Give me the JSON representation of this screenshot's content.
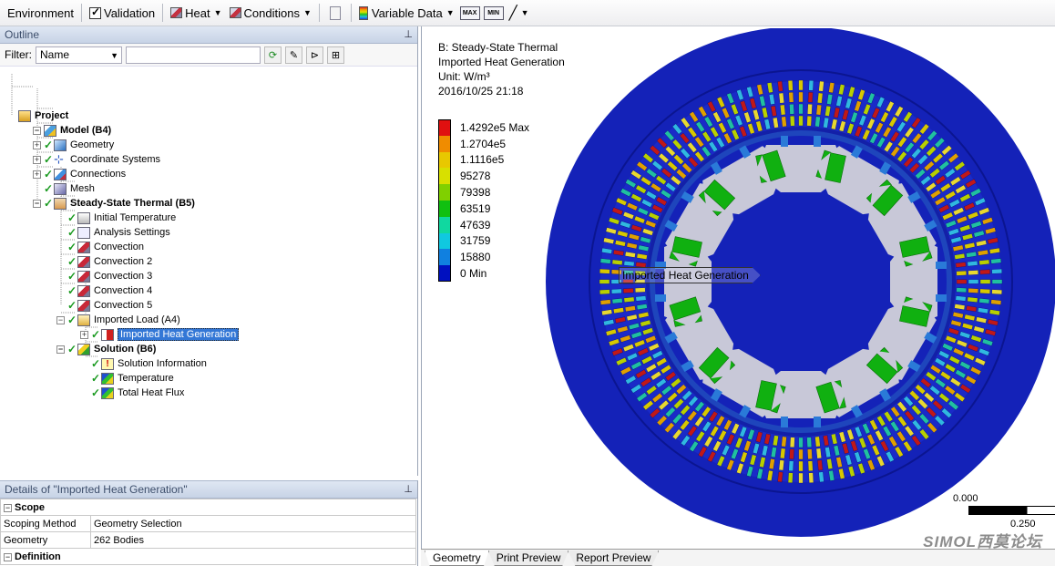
{
  "toolbar": {
    "environment": "Environment",
    "validation": "Validation",
    "heat": "Heat",
    "conditions": "Conditions",
    "variable_data": "Variable Data",
    "max_icon": "MAX",
    "min_icon": "MIN"
  },
  "outline": {
    "title": "Outline",
    "filter_label": "Filter:",
    "filter_value": "Name",
    "tree": [
      {
        "label": "Project",
        "level": 0,
        "bold": true,
        "icon": "project-icon",
        "tick": false,
        "expander": ""
      },
      {
        "label": "Model (B4)",
        "level": 1,
        "bold": true,
        "icon": "model-icon",
        "tick": false,
        "expander": "−"
      },
      {
        "label": "Geometry",
        "level": 2,
        "bold": false,
        "icon": "geometry-icon",
        "tick": true,
        "expander": "+"
      },
      {
        "label": "Coordinate Systems",
        "level": 2,
        "bold": false,
        "icon": "coordinate-icon",
        "tick": true,
        "expander": "+"
      },
      {
        "label": "Connections",
        "level": 2,
        "bold": false,
        "icon": "connections-icon",
        "tick": true,
        "expander": "+"
      },
      {
        "label": "Mesh",
        "level": 2,
        "bold": false,
        "icon": "mesh-icon",
        "tick": true,
        "expander": ""
      },
      {
        "label": "Steady-State Thermal (B5)",
        "level": 2,
        "bold": true,
        "icon": "thermal-icon",
        "tick": true,
        "expander": "−"
      },
      {
        "label": "Initial Temperature",
        "level": 3,
        "bold": false,
        "icon": "initial-temperature-icon",
        "tick": true,
        "expander": ""
      },
      {
        "label": "Analysis Settings",
        "level": 3,
        "bold": false,
        "icon": "settings-icon",
        "tick": true,
        "expander": ""
      },
      {
        "label": "Convection",
        "level": 3,
        "bold": false,
        "icon": "convection-icon",
        "tick": true,
        "expander": ""
      },
      {
        "label": "Convection 2",
        "level": 3,
        "bold": false,
        "icon": "convection-icon",
        "tick": true,
        "expander": ""
      },
      {
        "label": "Convection 3",
        "level": 3,
        "bold": false,
        "icon": "convection-icon",
        "tick": true,
        "expander": ""
      },
      {
        "label": "Convection 4",
        "level": 3,
        "bold": false,
        "icon": "convection-icon",
        "tick": true,
        "expander": ""
      },
      {
        "label": "Convection 5",
        "level": 3,
        "bold": false,
        "icon": "convection-icon",
        "tick": true,
        "expander": ""
      },
      {
        "label": "Imported Load (A4)",
        "level": 3,
        "bold": false,
        "icon": "imported-load-icon",
        "tick": true,
        "expander": "−"
      },
      {
        "label": "Imported Heat Generation",
        "level": 4,
        "bold": false,
        "icon": "heat-generation-icon",
        "tick": true,
        "expander": "+",
        "selected": true
      },
      {
        "label": "Solution (B6)",
        "level": 3,
        "bold": true,
        "icon": "solution-icon",
        "tick": true,
        "expander": "−"
      },
      {
        "label": "Solution Information",
        "level": 4,
        "bold": false,
        "icon": "solution-info-icon",
        "tick": true,
        "expander": ""
      },
      {
        "label": "Temperature",
        "level": 4,
        "bold": false,
        "icon": "result-icon",
        "tick": true,
        "expander": ""
      },
      {
        "label": "Total Heat Flux",
        "level": 4,
        "bold": false,
        "icon": "result-icon",
        "tick": true,
        "expander": ""
      }
    ]
  },
  "details": {
    "title": "Details of \"Imported Heat Generation\"",
    "scope_label": "Scope",
    "scoping_method_key": "Scoping Method",
    "scoping_method_value": "Geometry Selection",
    "geometry_key": "Geometry",
    "geometry_value": "262 Bodies",
    "definition_label": "Definition"
  },
  "graphics": {
    "analysis": "B: Steady-State Thermal",
    "result": "Imported Heat Generation",
    "unit": "Unit: W/m³",
    "date": "2016/10/25 21:18",
    "callout": "Imported Heat Generation",
    "legend": [
      {
        "label": "1.4292e5 Max",
        "color": "#e01010"
      },
      {
        "label": "1.2704e5",
        "color": "#f08c00"
      },
      {
        "label": "1.1116e5",
        "color": "#e8c800"
      },
      {
        "label": "95278",
        "color": "#d8e000"
      },
      {
        "label": "79398",
        "color": "#80d000"
      },
      {
        "label": "63519",
        "color": "#10c010"
      },
      {
        "label": "47639",
        "color": "#10d8a0"
      },
      {
        "label": "31759",
        "color": "#10c8e0"
      },
      {
        "label": "15880",
        "color": "#1080e0"
      },
      {
        "label": "0 Min",
        "color": "#0010c0"
      }
    ],
    "scale_min": "0.000",
    "scale_max": "0.250",
    "watermark": "SIMOL西莫论坛"
  },
  "tabs": [
    "Geometry",
    "Print Preview",
    "Report Preview"
  ],
  "colors": {
    "background_blue": "#1422b8",
    "stator_ring": "#1a2ac8",
    "slot_gray": "#c8c8d8",
    "selection": "#3377d6"
  }
}
